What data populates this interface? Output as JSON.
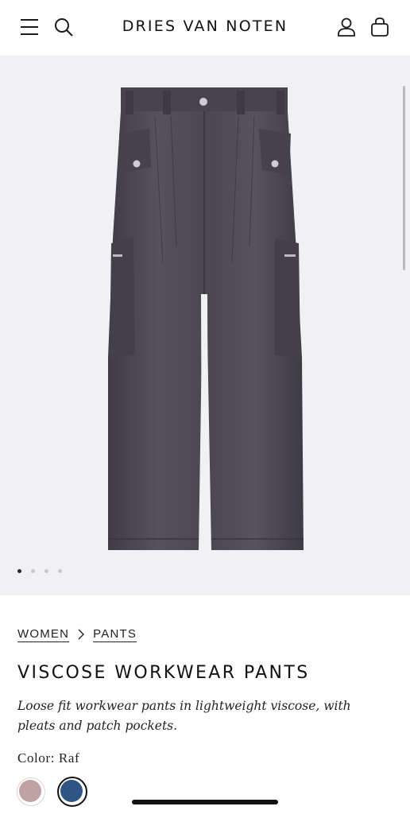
{
  "header": {
    "brand": "DRIES VAN NOTEN",
    "icons": [
      "menu-icon",
      "search-icon",
      "account-icon",
      "bag-icon"
    ]
  },
  "gallery": {
    "slide_count": 4,
    "active_slide": 1,
    "background": "#f1f1f3",
    "product_color": "#4a4752"
  },
  "breadcrumb": {
    "items": [
      "WOMEN",
      "PANTS"
    ]
  },
  "product": {
    "title": "VISCOSE WORKWEAR PANTS",
    "description": "Loose fit workwear pants in lightweight viscose, with pleats and patch pockets.",
    "color_label": "Color: Raf"
  },
  "swatches": [
    {
      "color": "#bfa2a2",
      "selected": false
    },
    {
      "color": "#2f5585",
      "selected": true
    }
  ]
}
